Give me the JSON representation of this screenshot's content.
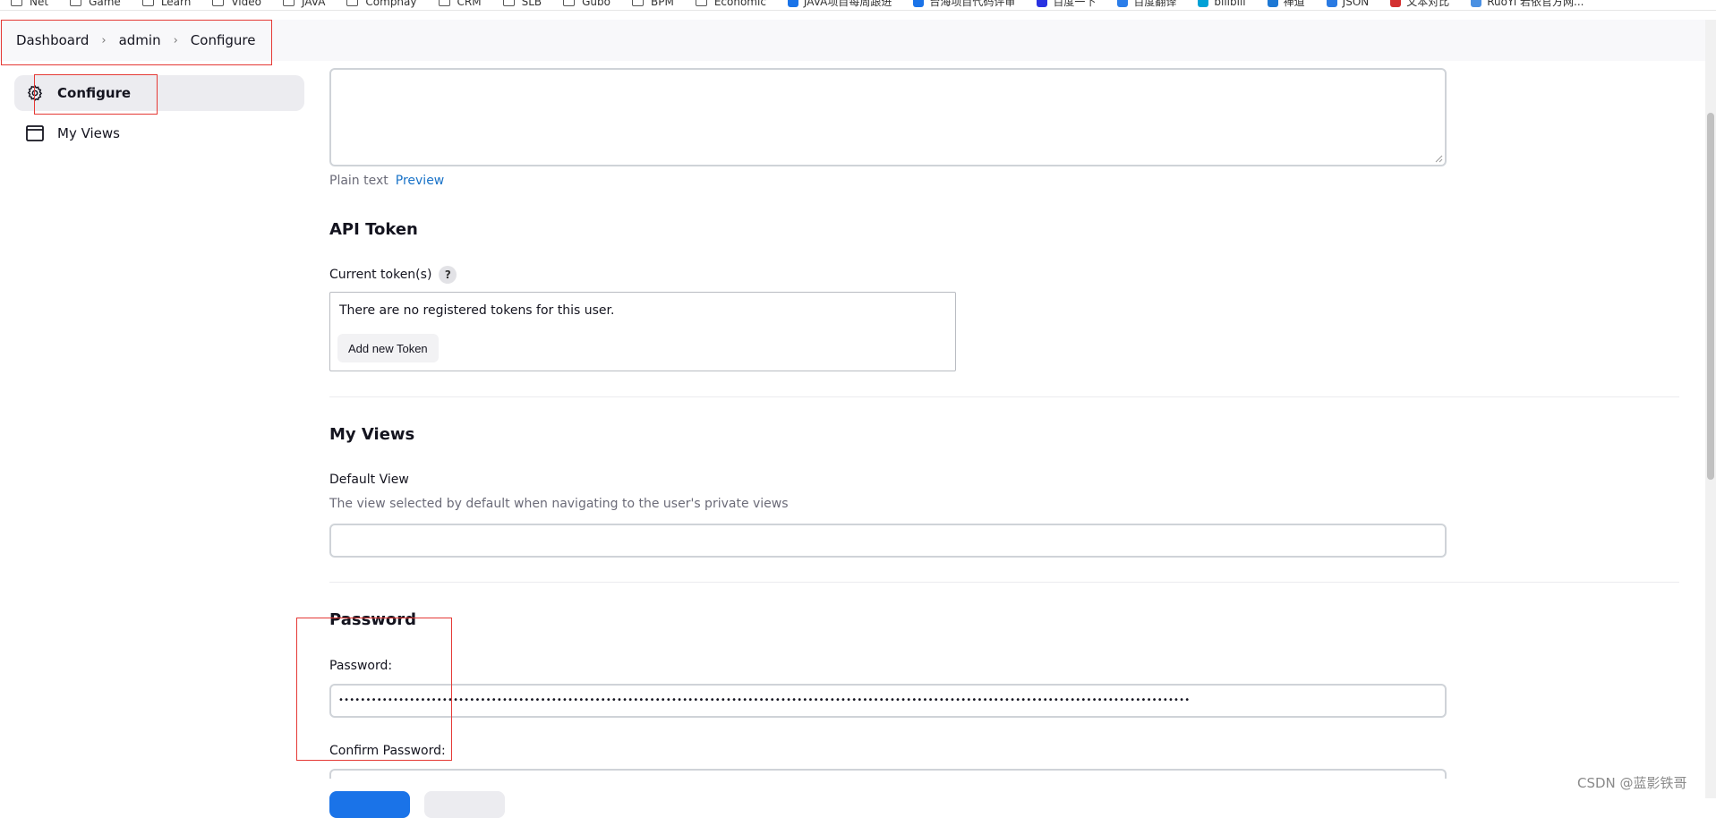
{
  "bookmarks": [
    {
      "label": "Net",
      "icon": "folder-icon"
    },
    {
      "label": "Game",
      "icon": "folder-icon"
    },
    {
      "label": "Learn",
      "icon": "folder-icon"
    },
    {
      "label": "Video",
      "icon": "folder-icon"
    },
    {
      "label": "JAVA",
      "icon": "folder-icon"
    },
    {
      "label": "Comphay",
      "icon": "folder-icon"
    },
    {
      "label": "CRM",
      "icon": "folder-icon"
    },
    {
      "label": "SLB",
      "icon": "folder-icon"
    },
    {
      "label": "Gubo",
      "icon": "folder-icon"
    },
    {
      "label": "BPM",
      "icon": "folder-icon"
    },
    {
      "label": "Economic",
      "icon": "folder-icon"
    },
    {
      "label": "JAVA项目每周跟进",
      "icon": "doc-icon"
    },
    {
      "label": "台海项目代码评审",
      "icon": "doc-icon"
    },
    {
      "label": "百度一下",
      "icon": "baidu-icon"
    },
    {
      "label": "百度翻译",
      "icon": "translate-icon"
    },
    {
      "label": "bilibili",
      "icon": "bilibili-icon"
    },
    {
      "label": "禅道",
      "icon": "zentao-icon"
    },
    {
      "label": "JSON",
      "icon": "json-icon"
    },
    {
      "label": "文本对比",
      "icon": "compare-icon"
    },
    {
      "label": "RuoYi 若依官方网...",
      "icon": "ruoyi-icon"
    }
  ],
  "breadcrumb": {
    "items": [
      "Dashboard",
      "admin",
      "Configure"
    ],
    "separator": "›"
  },
  "sidebar": {
    "items": [
      {
        "label": "Configure",
        "icon": "gear-icon",
        "active": true
      },
      {
        "label": "My Views",
        "icon": "window-icon",
        "active": false
      }
    ]
  },
  "description": {
    "format_label": "Plain text",
    "preview_link": "Preview"
  },
  "api_token": {
    "heading": "API Token",
    "current_label": "Current token(s)",
    "help": "?",
    "empty_message": "There are no registered tokens for this user.",
    "add_button": "Add new Token"
  },
  "my_views": {
    "heading": "My Views",
    "default_view_label": "Default View",
    "default_view_desc": "The view selected by default when navigating to the user's private views",
    "default_view_value": ""
  },
  "password": {
    "heading": "Password",
    "password_label": "Password:",
    "password_mask": "••••••••••••••••••••••••••••••••••••••••••••••••••••••••••••••••••••••••••••••••••••••••••••••••••••••••••••••••••••••••••••••••••••••••••••••••••••••••••••",
    "confirm_label": "Confirm Password:"
  },
  "watermark": "CSDN @蓝影铁哥",
  "colors": {
    "accent": "#1a73e8",
    "annotation_red": "#e53935",
    "link": "#1a73c8"
  }
}
